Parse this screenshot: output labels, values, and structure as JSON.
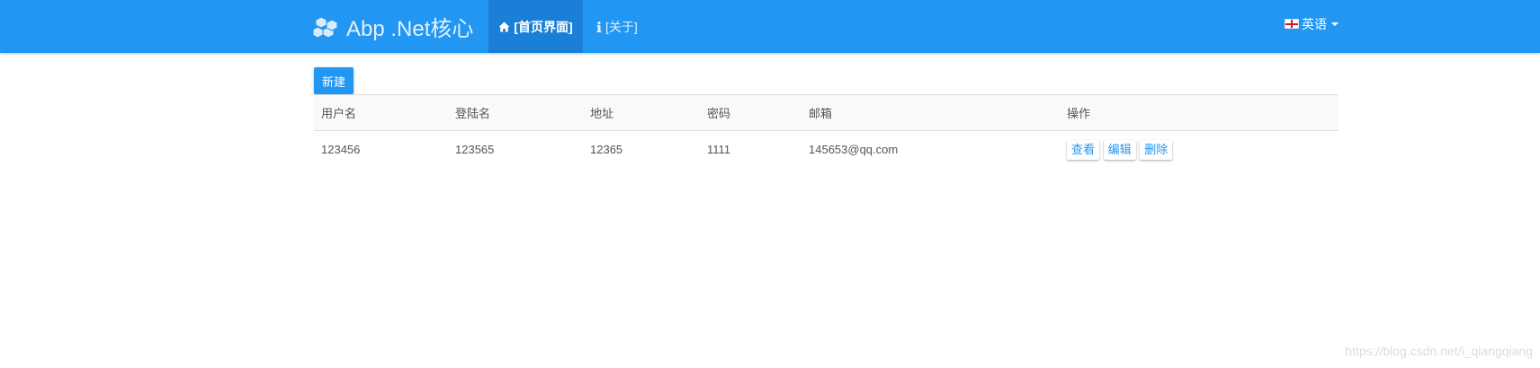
{
  "navbar": {
    "brand": "Abp .Net核心",
    "brand_icon": "cubes-icon",
    "items": [
      {
        "label": "[首页界面]",
        "icon": "home-icon",
        "active": true
      },
      {
        "label": "[关于]",
        "icon": "info-icon",
        "active": false
      }
    ],
    "language": {
      "label": "英语",
      "flag": "england-flag-icon"
    }
  },
  "toolbar": {
    "new_label": "新建"
  },
  "table": {
    "headers": [
      "用户名",
      "登陆名",
      "地址",
      "密码",
      "邮箱",
      "操作"
    ],
    "rows": [
      {
        "username": "123456",
        "login_name": "123565",
        "address": "12365",
        "password": "1111",
        "email": "145653@qq.com",
        "actions": [
          "查看",
          "编辑",
          "删除"
        ]
      }
    ]
  },
  "watermark": "https://blog.csdn.net/i_qiangqiang",
  "colors": {
    "primary": "#2196f3",
    "nav_active": "#1a7fd6",
    "text": "#555555"
  }
}
